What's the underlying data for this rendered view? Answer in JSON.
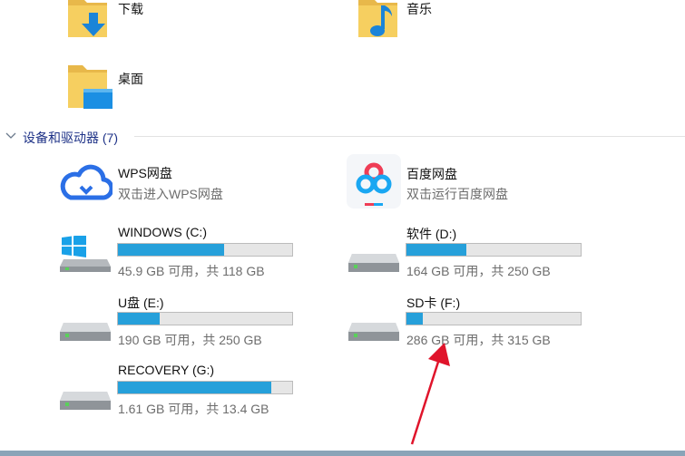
{
  "folders": [
    {
      "name": "下载",
      "icon": "folder-download-icon"
    },
    {
      "name": "音乐",
      "icon": "folder-music-icon"
    },
    {
      "name": "桌面",
      "icon": "folder-desktop-icon"
    }
  ],
  "group": {
    "title": "设备和驱动器 (7)",
    "icon": "chevron-down-icon"
  },
  "apps": [
    {
      "name": "WPS网盘",
      "sub": "双击进入WPS网盘",
      "icon": "wps-cloud-icon",
      "color": "#2b6fe6"
    },
    {
      "name": "百度网盘",
      "sub": "双击运行百度网盘",
      "icon": "baidu-netdisk-icon",
      "color": "#2aa3f0"
    }
  ],
  "drives": [
    {
      "name": "WINDOWS (C:)",
      "info": "45.9 GB 可用，共 118 GB",
      "used_fraction": 0.611,
      "icon": "windows-drive-icon"
    },
    {
      "name": "软件 (D:)",
      "info": "164 GB 可用，共 250 GB",
      "used_fraction": 0.344,
      "icon": "hard-drive-icon"
    },
    {
      "name": "U盘 (E:)",
      "info": "190 GB 可用，共 250 GB",
      "used_fraction": 0.24,
      "icon": "hard-drive-icon"
    },
    {
      "name": "SD卡 (F:)",
      "info": "286 GB 可用，共 315 GB",
      "used_fraction": 0.092,
      "icon": "hard-drive-icon"
    },
    {
      "name": "RECOVERY (G:)",
      "info": "1.61 GB 可用，共 13.4 GB",
      "used_fraction": 0.88,
      "icon": "hard-drive-icon"
    }
  ],
  "colors": {
    "accent": "#26a0da",
    "annotation_arrow": "#e0142b",
    "header_text": "#1e3287"
  }
}
